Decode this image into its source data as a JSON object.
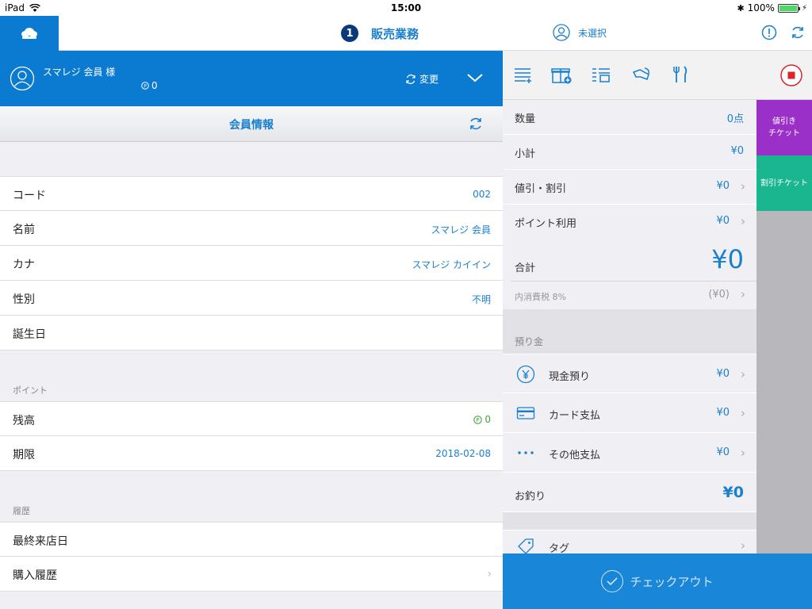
{
  "status_bar": {
    "device": "iPad",
    "time": "15:00",
    "battery": "100%",
    "battery_level": 1.0
  },
  "nav": {
    "badge": "1",
    "title": "販売業務",
    "staff_label": "未選択"
  },
  "member": {
    "name": "スマレジ 会員 様",
    "points": "0",
    "change_label": "変更"
  },
  "info": {
    "title": "会員情報",
    "rows": [
      {
        "label": "コード",
        "value": "002"
      },
      {
        "label": "名前",
        "value": "スマレジ 会員"
      },
      {
        "label": "カナ",
        "value": "スマレジ カイイン"
      },
      {
        "label": "性別",
        "value": "不明"
      },
      {
        "label": "誕生日",
        "value": ""
      }
    ],
    "points_section": "ポイント",
    "points_rows": [
      {
        "label": "残高",
        "value": "0"
      },
      {
        "label": "期限",
        "value": "2018-02-08"
      }
    ],
    "history_section": "履歴",
    "history_rows": [
      {
        "label": "最終来店日",
        "value": ""
      },
      {
        "label": "購入履歴",
        "value": ""
      }
    ]
  },
  "summary": {
    "qty_label": "数量",
    "qty_value": "0点",
    "subtotal_label": "小計",
    "subtotal_value": "¥0",
    "discount_label": "値引・割引",
    "discount_value": "¥0",
    "points_label": "ポイント利用",
    "points_value": "¥0",
    "total_label": "合計",
    "total_value": "¥0",
    "tax_label": "内消費税 8%",
    "tax_value": "(¥0)",
    "deposit_section": "預り金",
    "cash_label": "現金預り",
    "cash_value": "¥0",
    "card_label": "カード支払",
    "card_value": "¥0",
    "other_label": "その他支払",
    "other_value": "¥0",
    "change_label": "お釣り",
    "change_value": "¥0",
    "tag_label": "タグ"
  },
  "tickets": [
    {
      "label": "値引き\nチケット",
      "color": "#9b30c8"
    },
    {
      "label": "割引チケット",
      "color": "#19b68f"
    }
  ],
  "checkout_label": "チェックアウト",
  "colors": {
    "accent": "#0b7ad1",
    "link": "#1a7fcf",
    "points_green": "#3aaa35",
    "stop_red": "#d9262b"
  }
}
